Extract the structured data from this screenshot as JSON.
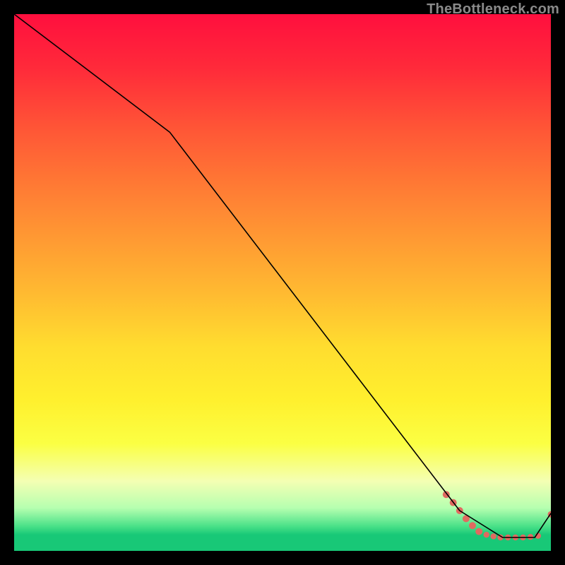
{
  "watermark": "TheBottleneck.com",
  "chart_data": {
    "type": "line",
    "title": "",
    "xlabel": "",
    "ylabel": "",
    "xlim": [
      0,
      100
    ],
    "ylim": [
      0,
      100
    ],
    "grid": false,
    "series": [
      {
        "name": "curve",
        "x": [
          0,
          29,
          83,
          91,
          97,
          100
        ],
        "y": [
          100,
          78,
          7.5,
          2.5,
          2.5,
          7
        ],
        "stroke": "#000000",
        "stroke_width": 1.6
      }
    ],
    "markers": {
      "name": "bottom-dots",
      "color": "#e06a60",
      "points": [
        {
          "x": 80.5,
          "y": 10.5,
          "r": 5
        },
        {
          "x": 81.8,
          "y": 9.0,
          "r": 5
        },
        {
          "x": 83.0,
          "y": 7.5,
          "r": 5
        },
        {
          "x": 84.2,
          "y": 6.0,
          "r": 5
        },
        {
          "x": 85.4,
          "y": 4.7,
          "r": 5
        },
        {
          "x": 86.6,
          "y": 3.6,
          "r": 5
        },
        {
          "x": 88.0,
          "y": 3.0,
          "r": 4.2
        },
        {
          "x": 89.3,
          "y": 2.7,
          "r": 4.2
        },
        {
          "x": 90.6,
          "y": 2.5,
          "r": 4.2
        },
        {
          "x": 92.0,
          "y": 2.5,
          "r": 4.2
        },
        {
          "x": 93.4,
          "y": 2.5,
          "r": 4.2
        },
        {
          "x": 94.8,
          "y": 2.5,
          "r": 4.2
        },
        {
          "x": 96.2,
          "y": 2.6,
          "r": 4.2
        },
        {
          "x": 97.6,
          "y": 2.8,
          "r": 4.2
        },
        {
          "x": 100.0,
          "y": 6.8,
          "r": 4.5
        }
      ]
    },
    "background_gradient_stops": [
      {
        "pos": 0.0,
        "color": "#ff0f3e"
      },
      {
        "pos": 0.5,
        "color": "#ffd22f"
      },
      {
        "pos": 0.8,
        "color": "#fbff43"
      },
      {
        "pos": 0.97,
        "color": "#18c877"
      }
    ]
  }
}
